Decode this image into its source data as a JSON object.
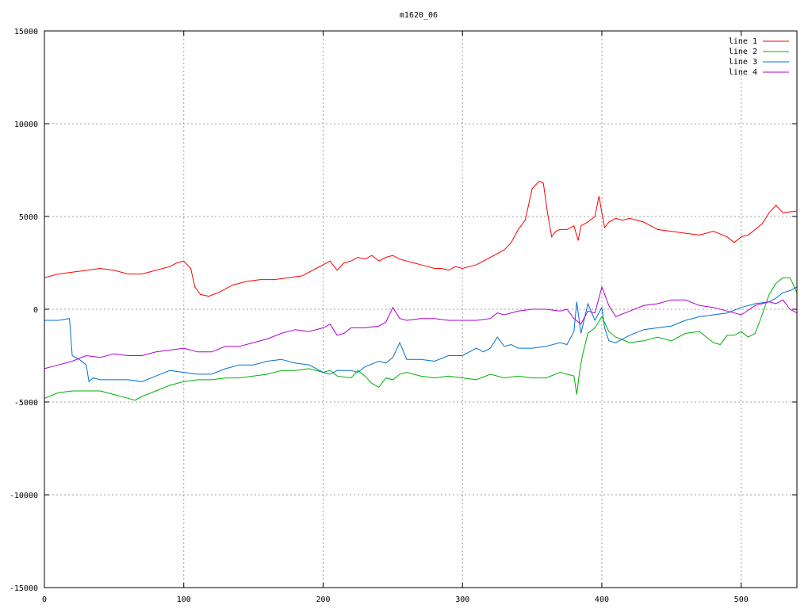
{
  "chart_data": {
    "type": "line",
    "title": "m1620_06",
    "xlabel": "",
    "ylabel": "",
    "xlim": [
      0,
      540
    ],
    "ylim": [
      -15000,
      15000
    ],
    "xticks": [
      0,
      100,
      200,
      300,
      400,
      500
    ],
    "yticks": [
      -15000,
      -10000,
      -5000,
      0,
      5000,
      10000,
      15000
    ],
    "grid": true,
    "legend_position": "top-right",
    "series": [
      {
        "name": "line 1",
        "color": "#ff0000",
        "x": [
          0,
          10,
          20,
          30,
          40,
          50,
          60,
          70,
          80,
          90,
          95,
          100,
          105,
          108,
          112,
          118,
          125,
          135,
          145,
          155,
          165,
          175,
          185,
          195,
          200,
          205,
          210,
          215,
          220,
          225,
          230,
          235,
          240,
          245,
          250,
          255,
          260,
          265,
          270,
          275,
          280,
          285,
          290,
          295,
          300,
          305,
          310,
          315,
          320,
          325,
          330,
          335,
          340,
          345,
          350,
          355,
          358,
          361,
          364,
          367,
          370,
          375,
          380,
          383,
          385,
          390,
          395,
          398,
          400,
          402,
          405,
          410,
          415,
          420,
          430,
          440,
          450,
          460,
          470,
          480,
          490,
          495,
          500,
          505,
          510,
          515,
          520,
          525,
          530,
          540
        ],
        "y": [
          1700,
          1900,
          2000,
          2100,
          2200,
          2100,
          1900,
          1900,
          2100,
          2300,
          2500,
          2600,
          2200,
          1200,
          800,
          700,
          900,
          1300,
          1500,
          1600,
          1600,
          1700,
          1800,
          2200,
          2400,
          2600,
          2100,
          2500,
          2600,
          2800,
          2700,
          2900,
          2600,
          2800,
          2900,
          2700,
          2600,
          2500,
          2400,
          2300,
          2200,
          2200,
          2100,
          2300,
          2200,
          2300,
          2400,
          2600,
          2800,
          3000,
          3200,
          3600,
          4300,
          4800,
          6500,
          6900,
          6800,
          5200,
          3900,
          4200,
          4300,
          4300,
          4500,
          3700,
          4500,
          4700,
          5000,
          6100,
          5200,
          4400,
          4700,
          4900,
          4800,
          4900,
          4700,
          4300,
          4200,
          4100,
          4000,
          4200,
          3900,
          3600,
          3900,
          4000,
          4300,
          4600,
          5200,
          5600,
          5200,
          5300
        ],
        "y_end_note": ""
      },
      {
        "name": "line 2",
        "color": "#00b000",
        "x": [
          0,
          10,
          20,
          30,
          40,
          50,
          60,
          65,
          70,
          80,
          90,
          100,
          110,
          120,
          130,
          140,
          150,
          160,
          170,
          180,
          190,
          200,
          205,
          210,
          220,
          225,
          230,
          235,
          240,
          245,
          250,
          255,
          260,
          270,
          280,
          290,
          300,
          310,
          320,
          330,
          340,
          350,
          360,
          370,
          380,
          382,
          384,
          386,
          390,
          395,
          400,
          405,
          410,
          420,
          430,
          440,
          450,
          460,
          470,
          475,
          480,
          485,
          490,
          495,
          500,
          505,
          510,
          515,
          520,
          525,
          530,
          535,
          540
        ],
        "y": [
          -4800,
          -4500,
          -4400,
          -4400,
          -4400,
          -4600,
          -4800,
          -4900,
          -4700,
          -4400,
          -4100,
          -3900,
          -3800,
          -3800,
          -3700,
          -3700,
          -3600,
          -3500,
          -3300,
          -3300,
          -3200,
          -3400,
          -3300,
          -3600,
          -3700,
          -3300,
          -3600,
          -4000,
          -4200,
          -3700,
          -3800,
          -3500,
          -3400,
          -3600,
          -3700,
          -3600,
          -3700,
          -3800,
          -3500,
          -3700,
          -3600,
          -3700,
          -3700,
          -3400,
          -3600,
          -4600,
          -3400,
          -2500,
          -1300,
          -1000,
          -400,
          -1200,
          -1500,
          -1800,
          -1700,
          -1500,
          -1700,
          -1300,
          -1200,
          -1500,
          -1800,
          -1900,
          -1400,
          -1400,
          -1200,
          -1500,
          -1300,
          -300,
          800,
          1400,
          1700,
          1700,
          900
        ]
      },
      {
        "name": "line 3",
        "color": "#0070d0",
        "x": [
          0,
          10,
          18,
          20,
          25,
          30,
          32,
          35,
          40,
          50,
          60,
          70,
          80,
          90,
          100,
          110,
          120,
          130,
          140,
          150,
          160,
          170,
          180,
          190,
          200,
          205,
          210,
          220,
          225,
          230,
          240,
          245,
          250,
          255,
          260,
          270,
          280,
          290,
          300,
          310,
          315,
          320,
          325,
          330,
          335,
          340,
          350,
          360,
          370,
          375,
          380,
          382,
          385,
          390,
          395,
          400,
          402,
          405,
          410,
          420,
          430,
          440,
          450,
          460,
          470,
          480,
          490,
          500,
          510,
          520,
          525,
          530,
          535,
          540
        ],
        "y": [
          -600,
          -600,
          -500,
          -2500,
          -2700,
          -3000,
          -3900,
          -3700,
          -3800,
          -3800,
          -3800,
          -3900,
          -3600,
          -3300,
          -3400,
          -3500,
          -3500,
          -3200,
          -3000,
          -3000,
          -2800,
          -2700,
          -2900,
          -3000,
          -3400,
          -3500,
          -3300,
          -3300,
          -3400,
          -3100,
          -2800,
          -2900,
          -2600,
          -1800,
          -2700,
          -2700,
          -2800,
          -2500,
          -2500,
          -2100,
          -2300,
          -2100,
          -1500,
          -2000,
          -1900,
          -2100,
          -2100,
          -2000,
          -1800,
          -1900,
          -1200,
          400,
          -1300,
          300,
          -600,
          100,
          -1000,
          -1700,
          -1800,
          -1400,
          -1100,
          -1000,
          -900,
          -600,
          -400,
          -300,
          -200,
          100,
          300,
          400,
          600,
          900,
          1000,
          1200
        ]
      },
      {
        "name": "line 4",
        "color": "#b000d0",
        "x": [
          0,
          10,
          20,
          30,
          40,
          50,
          60,
          70,
          80,
          90,
          100,
          110,
          120,
          130,
          140,
          150,
          160,
          170,
          180,
          190,
          200,
          205,
          210,
          215,
          220,
          230,
          240,
          245,
          250,
          255,
          260,
          270,
          280,
          290,
          300,
          310,
          320,
          325,
          330,
          340,
          350,
          360,
          370,
          375,
          380,
          385,
          390,
          395,
          400,
          405,
          410,
          420,
          430,
          440,
          450,
          460,
          470,
          480,
          490,
          500,
          510,
          520,
          525,
          530,
          535,
          540
        ],
        "y": [
          -3200,
          -3000,
          -2800,
          -2500,
          -2600,
          -2400,
          -2500,
          -2500,
          -2300,
          -2200,
          -2100,
          -2300,
          -2300,
          -2000,
          -2000,
          -1800,
          -1600,
          -1300,
          -1100,
          -1200,
          -1000,
          -800,
          -1400,
          -1300,
          -1000,
          -1000,
          -900,
          -700,
          100,
          -500,
          -600,
          -500,
          -500,
          -600,
          -600,
          -600,
          -500,
          -200,
          -300,
          -100,
          0,
          0,
          -100,
          0,
          -500,
          -800,
          -100,
          -200,
          1200,
          200,
          -400,
          -100,
          200,
          300,
          500,
          500,
          200,
          100,
          -100,
          -300,
          200,
          400,
          300,
          500,
          0,
          -200
        ]
      }
    ]
  }
}
